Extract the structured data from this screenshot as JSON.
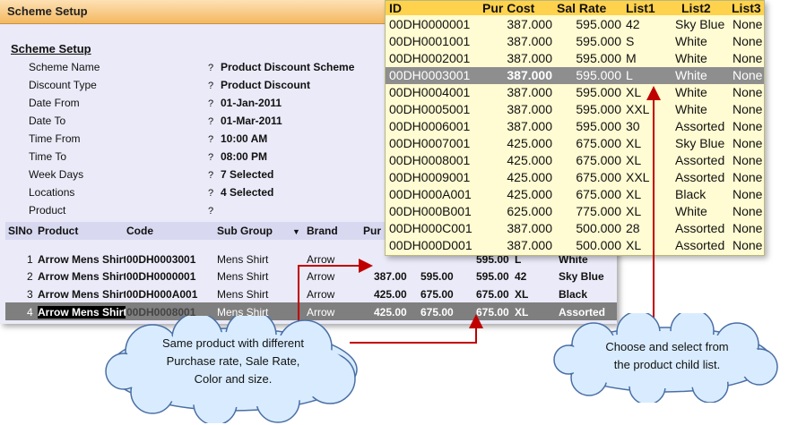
{
  "window": {
    "title": "Scheme Setup",
    "section_title": "Scheme Setup",
    "fields": [
      {
        "label": "Scheme Name",
        "value": "Product Discount Scheme"
      },
      {
        "label": "Discount Type",
        "value": "Product Discount"
      },
      {
        "label": "Date From",
        "value": "01-Jan-2011"
      },
      {
        "label": "Date To",
        "value": "01-Mar-2011"
      },
      {
        "label": "Time From",
        "value": "10:00 AM"
      },
      {
        "label": "Time To",
        "value": "08:00 PM"
      },
      {
        "label": "Week Days",
        "value": "7 Selected"
      },
      {
        "label": "Locations",
        "value": "4 Selected"
      },
      {
        "label": "Product",
        "value": ""
      }
    ],
    "separator": "?"
  },
  "grid": {
    "headers": {
      "slno": "SlNo",
      "product": "Product",
      "code": "Code",
      "subgroup": "Sub Group",
      "brand": "Brand",
      "pur": "Pur R"
    },
    "rows": [
      {
        "slno": "1",
        "product": "Arrow Mens Shirt",
        "code": "00DH0003001",
        "subgroup": "Mens Shirt",
        "brand": "Arrow",
        "pur": "",
        "sal": "",
        "rate": "595.00",
        "size": "L",
        "color": "White"
      },
      {
        "slno": "2",
        "product": "Arrow Mens Shirt",
        "code": "00DH0000001",
        "subgroup": "Mens Shirt",
        "brand": "Arrow",
        "pur": "387.00",
        "sal": "595.00",
        "rate": "595.00",
        "size": "42",
        "color": "Sky Blue"
      },
      {
        "slno": "3",
        "product": "Arrow Mens Shirt",
        "code": "00DH000A001",
        "subgroup": "Mens Shirt",
        "brand": "Arrow",
        "pur": "425.00",
        "sal": "675.00",
        "rate": "675.00",
        "size": "XL",
        "color": "Black"
      },
      {
        "slno": "4",
        "product": "Arrow Mens Shirt",
        "code": "00DH0008001",
        "subgroup": "Mens Shirt",
        "brand": "Arrow",
        "pur": "425.00",
        "sal": "675.00",
        "rate": "675.00",
        "size": "XL",
        "color": "Assorted"
      }
    ]
  },
  "dropdown": {
    "headers": {
      "id": "ID",
      "pur": "Pur Cost",
      "sal": "Sal Rate",
      "l1": "List1",
      "l2": "List2",
      "l3": "List3"
    },
    "rows": [
      {
        "id": "00DH0000001",
        "pur": "387.000",
        "sal": "595.000",
        "l1": "42",
        "l2": "Sky Blue",
        "l3": "None"
      },
      {
        "id": "00DH0001001",
        "pur": "387.000",
        "sal": "595.000",
        "l1": "S",
        "l2": "White",
        "l3": "None"
      },
      {
        "id": "00DH0002001",
        "pur": "387.000",
        "sal": "595.000",
        "l1": "M",
        "l2": "White",
        "l3": "None"
      },
      {
        "id": "00DH0003001",
        "pur": "387.000",
        "sal": "595.000",
        "l1": "L",
        "l2": "White",
        "l3": "None"
      },
      {
        "id": "00DH0004001",
        "pur": "387.000",
        "sal": "595.000",
        "l1": "XL",
        "l2": "White",
        "l3": "None"
      },
      {
        "id": "00DH0005001",
        "pur": "387.000",
        "sal": "595.000",
        "l1": "XXL",
        "l2": "White",
        "l3": "None"
      },
      {
        "id": "00DH0006001",
        "pur": "387.000",
        "sal": "595.000",
        "l1": "30",
        "l2": "Assorted",
        "l3": "None"
      },
      {
        "id": "00DH0007001",
        "pur": "425.000",
        "sal": "675.000",
        "l1": "XL",
        "l2": "Sky Blue",
        "l3": "None"
      },
      {
        "id": "00DH0008001",
        "pur": "425.000",
        "sal": "675.000",
        "l1": "XL",
        "l2": "Assorted",
        "l3": "None"
      },
      {
        "id": "00DH0009001",
        "pur": "425.000",
        "sal": "675.000",
        "l1": "XXL",
        "l2": "Assorted",
        "l3": "None"
      },
      {
        "id": "00DH000A001",
        "pur": "425.000",
        "sal": "675.000",
        "l1": "XL",
        "l2": "Black",
        "l3": "None"
      },
      {
        "id": "00DH000B001",
        "pur": "625.000",
        "sal": "775.000",
        "l1": "XL",
        "l2": "White",
        "l3": "None"
      },
      {
        "id": "00DH000C001",
        "pur": "387.000",
        "sal": "500.000",
        "l1": "28",
        "l2": "Assorted",
        "l3": "None"
      },
      {
        "id": "00DH000D001",
        "pur": "387.000",
        "sal": "500.000",
        "l1": "XL",
        "l2": "Assorted",
        "l3": "None"
      }
    ],
    "selected_index": 3
  },
  "callouts": {
    "left": [
      "Same product with different",
      "Purchase rate, Sale Rate,",
      "Color and size."
    ],
    "right": [
      "Choose and select from",
      "the product child list."
    ]
  },
  "colors": {
    "titlebar": "#f4b860",
    "dropdown_bg": "#fffbd2",
    "dropdown_header": "#ffd24d",
    "arrow": "#c00000",
    "cloud": "#d9ecff"
  }
}
